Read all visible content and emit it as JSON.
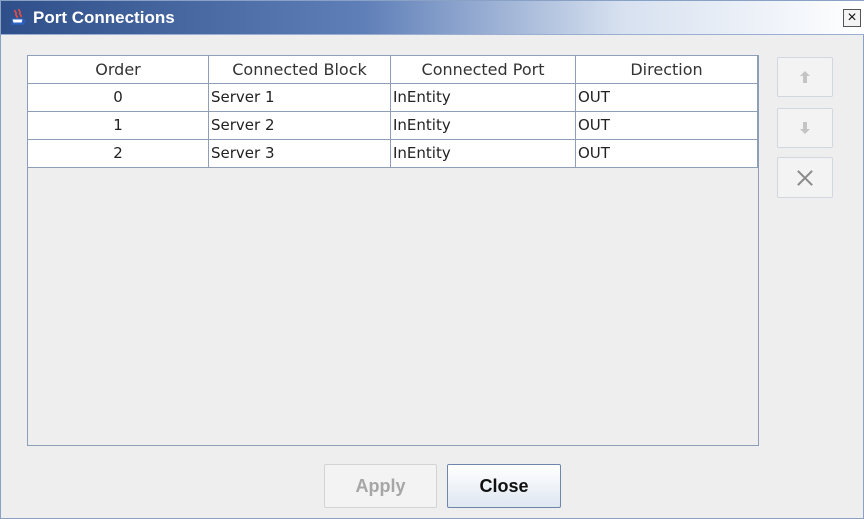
{
  "window": {
    "title": "Port Connections",
    "close_label": "×"
  },
  "table": {
    "columns": [
      "Order",
      "Connected Block",
      "Connected Port",
      "Direction"
    ],
    "rows": [
      {
        "order": "0",
        "connected_block": "Server 1",
        "connected_port": "InEntity",
        "direction": "OUT"
      },
      {
        "order": "1",
        "connected_block": "Server 2",
        "connected_port": "InEntity",
        "direction": "OUT"
      },
      {
        "order": "2",
        "connected_block": "Server 3",
        "connected_port": "InEntity",
        "direction": "OUT"
      }
    ]
  },
  "side_buttons": [
    {
      "name": "move-up",
      "icon": "arrow-up-icon",
      "enabled": false
    },
    {
      "name": "move-down",
      "icon": "arrow-down-icon",
      "enabled": false
    },
    {
      "name": "delete",
      "icon": "delete-icon",
      "enabled": true
    }
  ],
  "buttons": {
    "apply": "Apply",
    "close": "Close"
  },
  "colors": {
    "title_start": "#2f4f8a",
    "title_end": "#ffffff",
    "panel": "#eeeeee",
    "grid": "#8f9eb7",
    "disabled_text": "#a6a6a6"
  }
}
